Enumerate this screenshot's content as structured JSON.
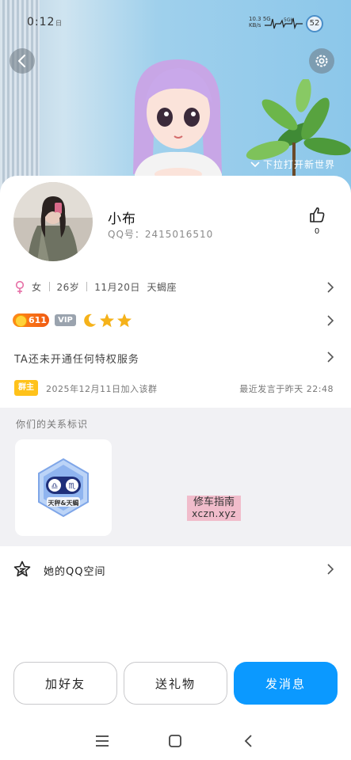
{
  "status_bar": {
    "time": "0:12",
    "extra_icon": "日",
    "net_speed_top": "10.3",
    "net_speed_bottom": "KB/s",
    "signal_1": "5G",
    "signal_2": "5GH",
    "battery": "52"
  },
  "hero": {
    "pull_hint": "下拉打开新世界",
    "back_icon": "chevron-left-icon",
    "settings_icon": "gear-icon"
  },
  "profile": {
    "nickname": "小布",
    "qq_number": "QQ号：2415016510",
    "like_count": "0",
    "gender_icon": "female-icon",
    "gender": "女",
    "age": "26岁",
    "birthday": "11月20日",
    "zodiac": "天蝎座"
  },
  "badges": {
    "level": "611",
    "vip": "VIP",
    "moon_icon": "moon-icon",
    "star_icon": "star-icon"
  },
  "permissions": {
    "text": "TA还未开通任何特权服务"
  },
  "group": {
    "owner_tag": "群主",
    "joined": "2025年12月11日加入该群",
    "last_message": "最近发言于昨天 22:48"
  },
  "relationship": {
    "title": "你们的关系标识",
    "badge_label": "天秤&天蝎"
  },
  "watermark": {
    "line1": "修车指南",
    "line2": "xczn.xyz"
  },
  "qzone": {
    "label": "她的QQ空间"
  },
  "actions": {
    "add_friend": "加好友",
    "send_gift": "送礼物",
    "send_message": "发消息"
  },
  "colors": {
    "primary": "#0b99ff",
    "level_orange": "#f05a12",
    "owner_yellow": "#ffc21a",
    "female_pink": "#e66fa6"
  }
}
